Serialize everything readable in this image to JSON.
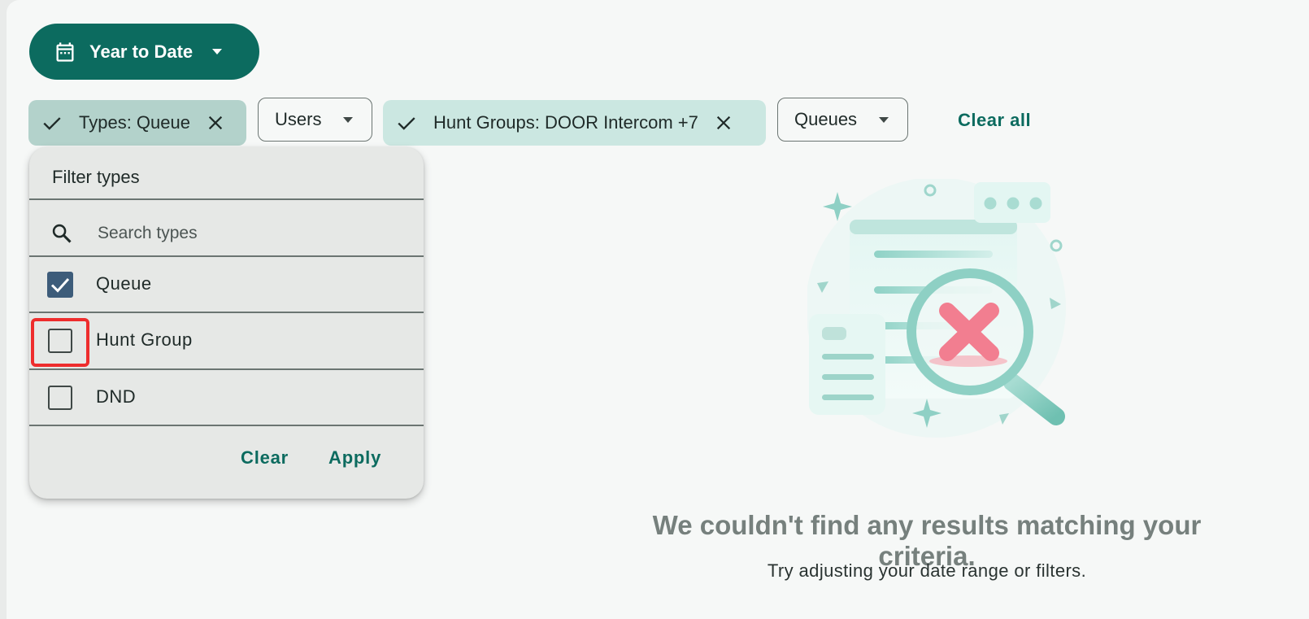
{
  "date_filter": {
    "label": "Year to Date"
  },
  "chips": {
    "types": {
      "label": "Types: Queue"
    },
    "users": {
      "label": "Users"
    },
    "hunt_groups": {
      "label": "Hunt Groups: DOOR Intercom +7"
    },
    "queues": {
      "label": "Queues"
    },
    "clear_all": "Clear all"
  },
  "filter_panel": {
    "title": "Filter types",
    "search_placeholder": "Search types",
    "options": [
      {
        "label": "Queue",
        "checked": true
      },
      {
        "label": "Hunt Group",
        "checked": false
      },
      {
        "label": "DND",
        "checked": false
      }
    ],
    "clear_label": "Clear",
    "apply_label": "Apply"
  },
  "empty_state": {
    "title": "We couldn't find any results matching your criteria.",
    "subtitle": "Try adjusting your date range or filters."
  },
  "colors": {
    "primary": "#0c6b5f",
    "chip_selected": "#b3d2cb",
    "chip_selected_light": "#cbe7e1",
    "checkbox_checked": "#3d5c7a",
    "highlight_box": "#ee2d2d"
  }
}
